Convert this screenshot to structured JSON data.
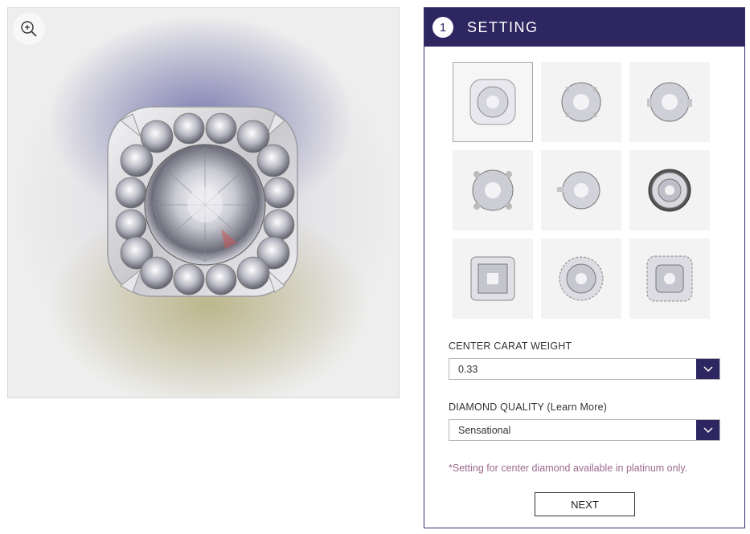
{
  "main_image": {
    "zoom_icon": "zoom-in-icon"
  },
  "panel": {
    "step_number": "1",
    "title": "SETTING",
    "thumbnails": [
      {
        "style": "cushion-halo"
      },
      {
        "style": "round-solitaire"
      },
      {
        "style": "round-solitaire-side"
      },
      {
        "style": "round-four-prong"
      },
      {
        "style": "round-angled"
      },
      {
        "style": "round-halo-dark"
      },
      {
        "style": "princess-halo"
      },
      {
        "style": "round-halo"
      },
      {
        "style": "cushion-square-halo"
      }
    ],
    "selected_thumbnail": 0,
    "carat_label": "CENTER CARAT WEIGHT",
    "carat_value": "0.33",
    "quality_label": "DIAMOND QUALITY (Learn More)",
    "quality_value": "Sensational",
    "note": "*Setting for center diamond available in platinum only.",
    "next_label": "NEXT"
  },
  "colors": {
    "brand": "#2e2660",
    "note": "#9b6a8c"
  }
}
